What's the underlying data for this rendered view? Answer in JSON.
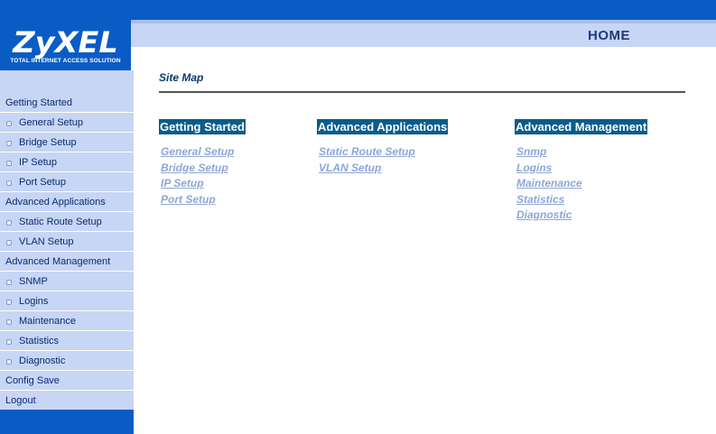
{
  "brand": {
    "name": "ZyXEL",
    "tagline": "TOTAL INTERNET ACCESS SOLUTION"
  },
  "header": {
    "title": "HOME"
  },
  "sidebar": {
    "items": [
      {
        "label": "Getting Started",
        "type": "section"
      },
      {
        "label": "General Setup",
        "type": "sub"
      },
      {
        "label": "Bridge Setup",
        "type": "sub"
      },
      {
        "label": "IP Setup",
        "type": "sub"
      },
      {
        "label": "Port Setup",
        "type": "sub"
      },
      {
        "label": "Advanced Applications",
        "type": "section"
      },
      {
        "label": "Static Route Setup",
        "type": "sub"
      },
      {
        "label": "VLAN Setup",
        "type": "sub"
      },
      {
        "label": "Advanced Management",
        "type": "section"
      },
      {
        "label": "SNMP",
        "type": "sub"
      },
      {
        "label": "Logins",
        "type": "sub"
      },
      {
        "label": "Maintenance",
        "type": "sub"
      },
      {
        "label": "Statistics",
        "type": "sub"
      },
      {
        "label": "Diagnostic",
        "type": "sub"
      },
      {
        "label": "Config Save",
        "type": "section"
      },
      {
        "label": "Logout",
        "type": "section"
      }
    ]
  },
  "main": {
    "title": "Site Map",
    "columns": [
      {
        "heading": "Getting Started",
        "links": [
          "General Setup",
          "Bridge Setup",
          "IP Setup",
          "Port Setup"
        ]
      },
      {
        "heading": "Advanced Applications",
        "links": [
          "Static Route Setup",
          "VLAN Setup"
        ]
      },
      {
        "heading": "Advanced Management",
        "links": [
          "Snmp",
          "Logins",
          "Maintenance",
          "Statistics",
          "Diagnostic"
        ]
      }
    ]
  },
  "colors": {
    "primary_blue": "#0a5cc4",
    "sidebar_bg": "#c6d6f4",
    "heading_bg": "#0a5c8c",
    "link": "#8ea6d6"
  }
}
